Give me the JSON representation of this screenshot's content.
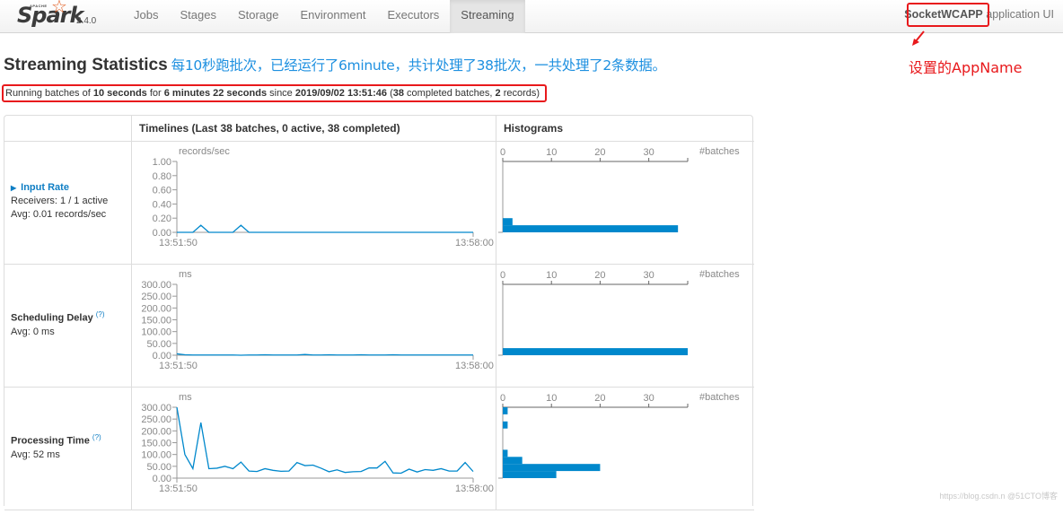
{
  "navbar": {
    "brand_apache": "APACHE",
    "brand_name": "Spark",
    "version": "2.4.0",
    "tabs": [
      {
        "label": "Jobs",
        "active": false
      },
      {
        "label": "Stages",
        "active": false
      },
      {
        "label": "Storage",
        "active": false
      },
      {
        "label": "Environment",
        "active": false
      },
      {
        "label": "Executors",
        "active": false
      },
      {
        "label": "Streaming",
        "active": true
      }
    ],
    "app_name": "SocketWCAPP",
    "app_suffix": " application UI"
  },
  "annotations": {
    "app_name_label": "设置的AppName",
    "title_note": "每10秒跑批次，已经运行了6minute，共计处理了38批次，一共处理了2条数据。",
    "highlight_color": "#e8191c",
    "note_color": "#1e90e0"
  },
  "page": {
    "title": "Streaming Statistics",
    "summary": {
      "p1": "Running batches of ",
      "batch_interval": "10 seconds",
      "p2": " for ",
      "duration": "6 minutes 22 seconds",
      "p3": " since ",
      "start_time": "2019/09/02 13:51:46",
      "p4": " (",
      "completed_batches": "38",
      "p5": " completed batches, ",
      "records": "2",
      "p6": " records)"
    }
  },
  "table": {
    "headers": [
      "",
      "Timelines (Last 38 batches, 0 active, 38 completed)",
      "Histograms"
    ],
    "rows": [
      {
        "title": "Input Rate",
        "title_is_link": true,
        "lines": [
          "Receivers: 1 / 1 active",
          "Avg: 0.01 records/sec"
        ]
      },
      {
        "title": "Scheduling Delay",
        "help": "(?)",
        "lines": [
          "Avg: 0 ms"
        ]
      },
      {
        "title": "Processing Time",
        "help": "(?)",
        "lines": [
          "Avg: 52 ms"
        ]
      }
    ]
  },
  "chart_data": [
    {
      "type": "line",
      "name": "input-rate-timeline",
      "ylabel": "records/sec",
      "ylim": [
        0,
        1
      ],
      "yticks": [
        "0.00",
        "0.20",
        "0.40",
        "0.60",
        "0.80",
        "1.00"
      ],
      "xtick_labels": [
        "13:51:50",
        "13:58:00"
      ],
      "values": [
        0,
        0,
        0,
        0.1,
        0,
        0,
        0,
        0,
        0.1,
        0,
        0,
        0,
        0,
        0,
        0,
        0,
        0,
        0,
        0,
        0,
        0,
        0,
        0,
        0,
        0,
        0,
        0,
        0,
        0,
        0,
        0,
        0,
        0,
        0,
        0,
        0,
        0,
        0
      ],
      "color": "#0088cc"
    },
    {
      "type": "bar",
      "name": "input-rate-histogram",
      "orientation": "horizontal",
      "xlabel": "#batches",
      "xticks": [
        0,
        10,
        20,
        30
      ],
      "xlim": [
        0,
        38
      ],
      "bins": [
        {
          "from": 0,
          "to": 0.1,
          "count": 36
        },
        {
          "from": 0.1,
          "to": 0.2,
          "count": 2
        }
      ],
      "ylim": [
        0,
        1
      ],
      "color": "#0088cc"
    },
    {
      "type": "line",
      "name": "scheduling-delay-timeline",
      "ylabel": "ms",
      "ylim": [
        0,
        300
      ],
      "yticks": [
        "0.00",
        "50.00",
        "100.00",
        "150.00",
        "200.00",
        "250.00",
        "300.00"
      ],
      "xtick_labels": [
        "13:51:50",
        "13:58:00"
      ],
      "values": [
        6,
        2,
        1,
        1,
        1,
        1,
        1,
        1,
        0,
        1,
        1,
        2,
        1,
        1,
        1,
        1,
        3,
        1,
        1,
        2,
        1,
        1,
        1,
        2,
        1,
        1,
        1,
        2,
        1,
        1,
        1,
        1,
        1,
        1,
        1,
        1,
        1,
        1
      ],
      "color": "#0088cc"
    },
    {
      "type": "bar",
      "name": "scheduling-delay-histogram",
      "orientation": "horizontal",
      "xlabel": "#batches",
      "xticks": [
        0,
        10,
        20,
        30
      ],
      "xlim": [
        0,
        38
      ],
      "bins": [
        {
          "from": 0,
          "to": 30,
          "count": 38
        }
      ],
      "ylim": [
        0,
        300
      ],
      "color": "#0088cc"
    },
    {
      "type": "line",
      "name": "processing-time-timeline",
      "ylabel": "ms",
      "ylim": [
        0,
        300
      ],
      "yticks": [
        "0.00",
        "50.00",
        "100.00",
        "150.00",
        "200.00",
        "250.00",
        "300.00"
      ],
      "xtick_labels": [
        "13:51:50",
        "13:58:00"
      ],
      "values": [
        300,
        100,
        40,
        235,
        40,
        42,
        50,
        40,
        68,
        30,
        28,
        40,
        33,
        29,
        30,
        66,
        53,
        55,
        42,
        27,
        35,
        24,
        27,
        28,
        43,
        43,
        71,
        22,
        21,
        38,
        26,
        36,
        33,
        40,
        30,
        30,
        66,
        28
      ],
      "color": "#0088cc"
    },
    {
      "type": "bar",
      "name": "processing-time-histogram",
      "orientation": "horizontal",
      "xlabel": "#batches",
      "xticks": [
        0,
        10,
        20,
        30
      ],
      "xlim": [
        0,
        38
      ],
      "bins": [
        {
          "from": 0,
          "to": 30,
          "count": 11
        },
        {
          "from": 30,
          "to": 60,
          "count": 20
        },
        {
          "from": 60,
          "to": 90,
          "count": 4
        },
        {
          "from": 90,
          "to": 120,
          "count": 1
        },
        {
          "from": 120,
          "to": 150,
          "count": 0
        },
        {
          "from": 150,
          "to": 180,
          "count": 0
        },
        {
          "from": 180,
          "to": 210,
          "count": 0
        },
        {
          "from": 210,
          "to": 240,
          "count": 1
        },
        {
          "from": 240,
          "to": 270,
          "count": 0
        },
        {
          "from": 270,
          "to": 300,
          "count": 1
        }
      ],
      "ylim": [
        0,
        300
      ],
      "color": "#0088cc"
    }
  ],
  "watermark": "https://blog.csdn.n @51CTO博客"
}
